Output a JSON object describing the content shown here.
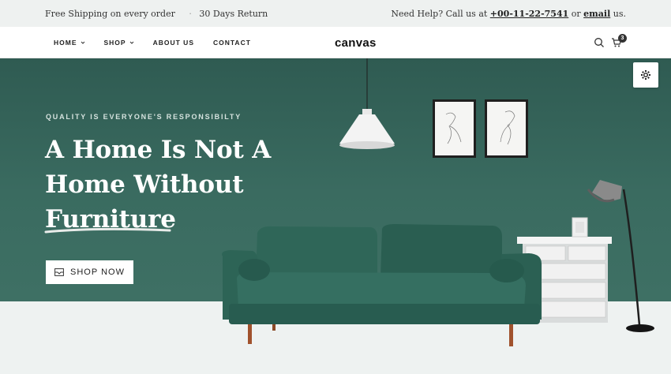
{
  "topbar": {
    "shipping": "Free Shipping on every order",
    "separator": "·",
    "returns": "30 Days Return",
    "help_prefix": "Need Help? Call us at",
    "phone": "+00-11-22-7541",
    "or": "or",
    "email": "email",
    "suffix": "us."
  },
  "nav": {
    "items": [
      {
        "label": "HOME",
        "dropdown": true
      },
      {
        "label": "SHOP",
        "dropdown": true
      },
      {
        "label": "ABOUT US",
        "dropdown": false
      },
      {
        "label": "CONTACT",
        "dropdown": false
      }
    ],
    "logo": "canvas",
    "cart_count": "3",
    "icons": [
      "search-icon",
      "cart-icon"
    ]
  },
  "hero": {
    "eyebrow": "QUALITY IS EVERYONE'S RESPONSIBILTY",
    "headline_lines": [
      "A Home Is Not A",
      "Home Without",
      "Furniture"
    ],
    "button_label": "SHOP NOW",
    "button_icon": "mail-icon",
    "settings_icon": "gear-icon"
  },
  "colors": {
    "hero_bg": "#3a6b60",
    "sofa": "#2e6558",
    "floor": "#eef2f1",
    "text_dark": "#222222"
  }
}
